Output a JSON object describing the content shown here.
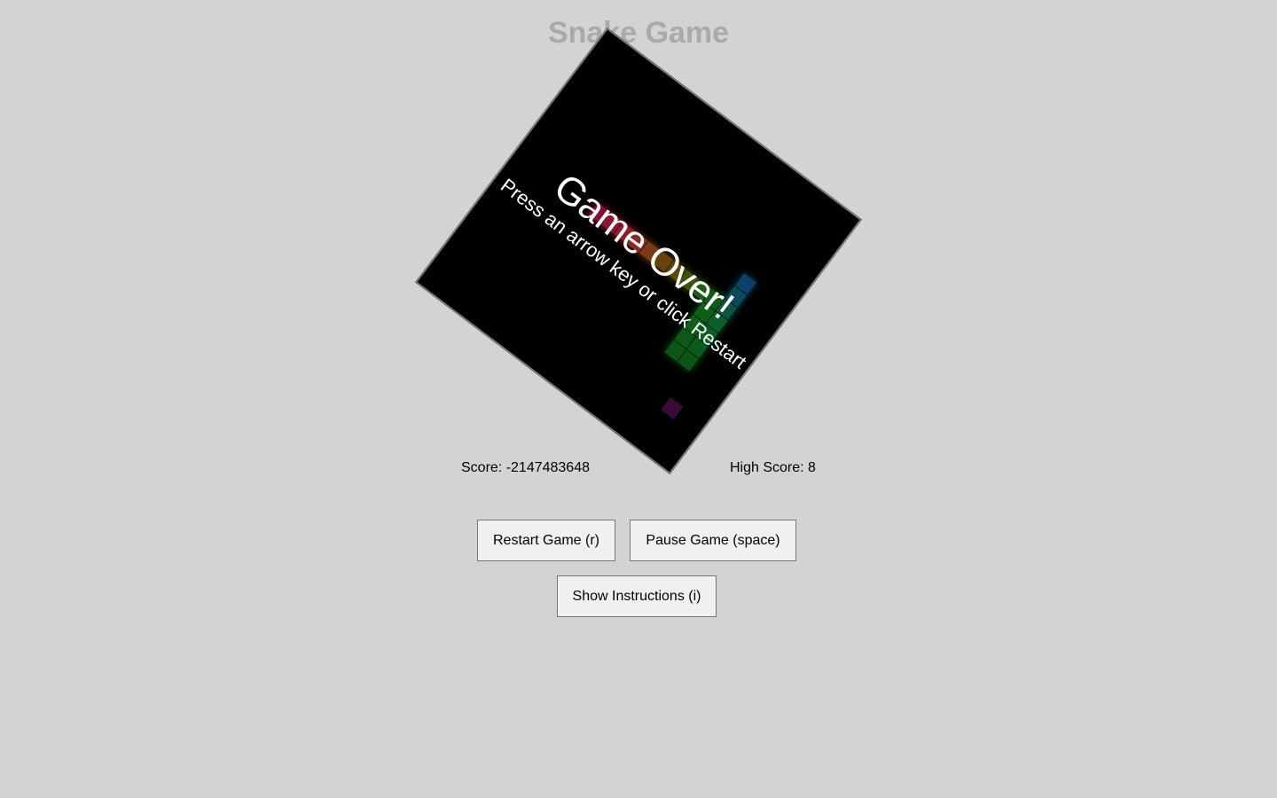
{
  "page": {
    "title": "Snake Game"
  },
  "board": {
    "background": "#000000",
    "rotation_deg": 37,
    "grid_size": 20,
    "snake_cells": [
      {
        "col": 6,
        "row": 9,
        "color": "#8a0f35"
      },
      {
        "col": 7,
        "row": 9,
        "color": "#8e1530"
      },
      {
        "col": 8,
        "row": 9,
        "color": "#921c2b"
      },
      {
        "col": 9,
        "row": 9,
        "color": "#8a2a22"
      },
      {
        "col": 10,
        "row": 9,
        "color": "#7a3a18"
      },
      {
        "col": 11,
        "row": 9,
        "color": "#6a4210"
      },
      {
        "col": 12,
        "row": 9,
        "color": "#5a4a0c"
      },
      {
        "col": 13,
        "row": 9,
        "color": "#3d5210"
      },
      {
        "col": 14,
        "row": 9,
        "color": "#215a14"
      },
      {
        "col": 15,
        "row": 9,
        "color": "#0c5e18"
      },
      {
        "col": 15,
        "row": 10,
        "color": "#0e6018"
      },
      {
        "col": 15,
        "row": 11,
        "color": "#106018"
      },
      {
        "col": 15,
        "row": 12,
        "color": "#0e5a18"
      },
      {
        "col": 15,
        "row": 13,
        "color": "#0a5614"
      },
      {
        "col": 16,
        "row": 9,
        "color": "#0a5440"
      },
      {
        "col": 16,
        "row": 8,
        "color": "#0a4a58"
      },
      {
        "col": 16,
        "row": 7,
        "color": "#0a4068"
      },
      {
        "col": 16,
        "row": 10,
        "color": "#0b5f2a"
      },
      {
        "col": 16,
        "row": 11,
        "color": "#0b5e22"
      },
      {
        "col": 16,
        "row": 12,
        "color": "#0c5a1a"
      },
      {
        "col": 16,
        "row": 13,
        "color": "#0a5214"
      }
    ],
    "food": {
      "col": 17,
      "row": 16,
      "color": "#3a0a3a"
    }
  },
  "overlay": {
    "title": "Game Over!",
    "subtitle": "Press an arrow key or click Restart"
  },
  "scores": {
    "score_label": "Score: -2147483648",
    "high_score_label": "High Score: 8"
  },
  "buttons": {
    "restart": "Restart Game (r)",
    "pause": "Pause Game (space)",
    "instructions": "Show Instructions (i)"
  }
}
